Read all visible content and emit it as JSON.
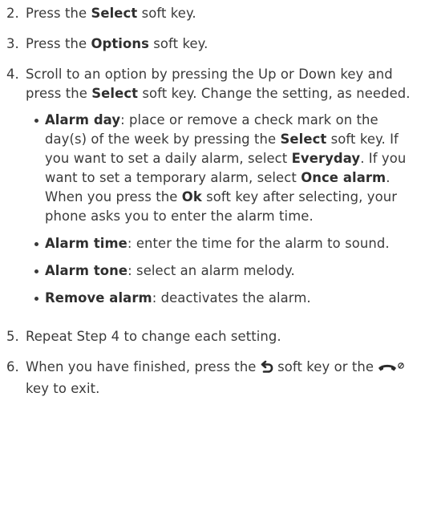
{
  "steps": [
    {
      "number": "2.",
      "parts": [
        "Press the ",
        "Select",
        " soft key."
      ]
    },
    {
      "number": "3.",
      "parts": [
        "Press the ",
        "Options",
        " soft key."
      ]
    },
    {
      "number": "4.",
      "parts": [
        "Scroll to an option by pressing the Up or Down key and press the ",
        "Select",
        " soft key. Change the setting, as needed."
      ],
      "bullets": [
        {
          "parts": [
            "Alarm day",
            ": place or remove a check mark on the day(s) of the week by pressing the ",
            "Select",
            " soft key. If you want to set a daily alarm, select ",
            "Everyday",
            ". If you want to set a temporary alarm, select ",
            "Once alarm",
            ". When you press the ",
            "Ok",
            " soft key after selecting, your phone asks you to enter the alarm time."
          ]
        },
        {
          "parts": [
            "Alarm time",
            ": enter the time for the alarm to sound."
          ]
        },
        {
          "parts": [
            "Alarm tone",
            ": select an alarm melody."
          ]
        },
        {
          "parts": [
            "Remove alarm",
            ": deactivates the alarm."
          ]
        }
      ]
    },
    {
      "number": "5.",
      "parts": [
        "Repeat Step 4 to change each setting."
      ]
    },
    {
      "number": "6.",
      "parts": [
        "When you have finished, press the ",
        " soft key or the ",
        " key to exit."
      ],
      "icons": [
        "back-arrow-icon",
        "end-power-key-icon"
      ]
    }
  ]
}
